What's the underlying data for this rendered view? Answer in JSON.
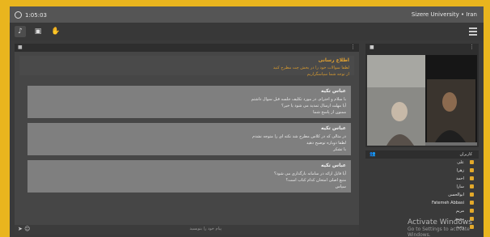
{
  "topbar": {
    "clock": "1:05:03",
    "title": "Sizere University • Iran"
  },
  "chat": {
    "notice_title": "ﺍﻃﻼﻉ ﺭﺳﺎﻧﯽ",
    "notice_body": "ﻟﻄﻔﺎ ﺳﻮﺍﻻﺕ ﺧﻮﺩ ﺭﺍ ﺩﺭ ﺑﺨﺶ ﭼﺖ ﻣﻄﺮﺡ ﮐﻨﯿﺪ",
    "notice_body2": "ﺍﺯ ﺗﻮﺟﻪ ﺷﻤﺎ ﺳﭙﺎﺳﮕﺰﺍﺭﯾﻢ",
    "messages": [
      {
        "sender": "ﻋﺒﺎﺱ ﺗﮑﯿﻪ",
        "lines": [
          "ﺑﺎ ﺳﻼﻡ ﻭ ﺍﺣﺘﺮﺍﻡ. ﺩﺭ ﻣﻮﺭﺩ ﺗﮑﻠﯿﻒ ﺟﻠﺴﻪ ﻗﺒﻞ ﺳﻮﺍﻝ ﺩﺍﺷﺘﻢ",
          "ﺁﯾﺎ ﻣﻬﻠﺖ ﺍﺭﺳﺎﻝ ﺗﻤﺪﯾﺪ ﻣﯽ ﺷﻮﺩ ﯾﺎ ﺧﯿﺮ؟",
          "ﻣﻤﻨﻮﻥ ﺍﺯ ﭘﺎﺳﺦ ﺷﻤﺎ"
        ]
      },
      {
        "sender": "ﻋﺒﺎﺱ ﺗﮑﯿﻪ",
        "lines": [
          "ﺩﺭ ﻣﺜﺎﻟﯽ ﮐﻪ ﺩﺭ ﮐﻼﺱ ﻣﻄﺮﺡ ﺷﺪ ﻧﮑﺘﻪ ﺍﯼ ﺭﺍ ﻣﺘﻮﺟﻪ ﻧﺸﺪﻡ",
          "ﻟﻄﻔﺎ ﺩﻭﺑﺎﺭﻩ ﺗﻮﺿﯿﺢ ﺩﻫﯿﺪ",
          "ﺑﺎ ﺗﺸﮑﺮ"
        ]
      },
      {
        "sender": "ﻋﺒﺎﺱ ﺗﮑﯿﻪ",
        "lines": [
          "ﺁﯾﺎ ﻓﺎﯾﻞ ﺍﺭﺍﺋﻪ ﺩﺭ ﺳﺎﻣﺎﻧﻪ ﺑﺎﺭﮔﺬﺍﺭﯼ ﻣﯽ ﺷﻮﺩ؟",
          "ﻣﻨﺒﻊ ﺍﺻﻠﯽ ﺍﻣﺘﺤﺎﻥ ﮐﺪﺍﻡ ﮐﺘﺎﺏ ﺍﺳﺖ؟",
          "ﺳﭙﺎﺱ"
        ]
      }
    ],
    "input_placeholder": "ﭘﯿﺎﻡ ﺧﻮﺩ ﺭﺍ ﺑﻨﻮﯾﺴﯿﺪ"
  },
  "users": {
    "title": "ﮐﺎﺭﺑﺮﺍﻥ",
    "list": [
      "ﻋﻠﯽ",
      "ﺯﻫﺮﺍ",
      "ﺍﺣﻤﺪ",
      "ﺳﺎﺭﺍ",
      "ﺍﺑﻮﺍﻟﺤﺴﻦ",
      "Fatemeh Abbasi",
      "ﻣﺮﯾﻢ",
      "ﻣﺤﻤﺪ",
      "ﻭﺣﯿﺪ"
    ]
  },
  "watermark": {
    "title": "Activate Windows",
    "subtitle": "Go to Settings to activate Windows."
  }
}
